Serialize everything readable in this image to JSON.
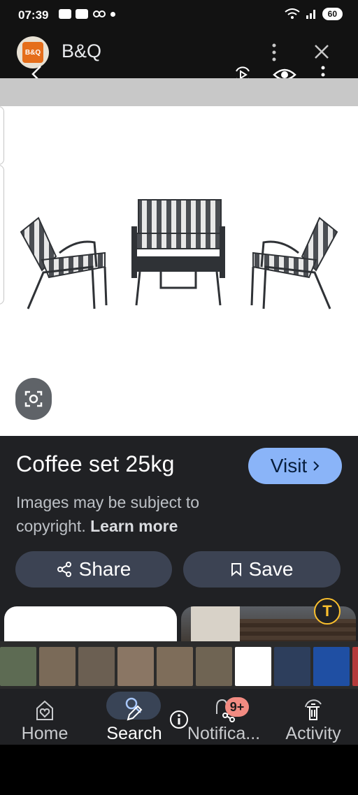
{
  "status_bar": {
    "time": "07:39",
    "battery": "60"
  },
  "header": {
    "brand_logo_text": "B&Q",
    "brand_name": "B&Q"
  },
  "product": {
    "title": "Coffee set 25kg",
    "visit_label": "Visit",
    "copyright_text": "Images may be subject to copyright.",
    "learn_more": "Learn more",
    "share_label": "Share",
    "save_label": "Save"
  },
  "visual_search": {
    "text_icon": "T"
  },
  "thumbnails": {
    "colors": [
      "#5d6b53",
      "#7a6a58",
      "#6b5f52",
      "#8a7664",
      "#7e6d5a",
      "#6f6453",
      "#ffffff",
      "#2d3e5c",
      "#1f4fa3",
      "#b43a3a",
      "#a8825e",
      "#d5c7b2",
      "#3b2f2c",
      "#e0c29a"
    ]
  },
  "bottom_nav": {
    "items": [
      {
        "label": "Home"
      },
      {
        "label": "Search"
      },
      {
        "label": "Notifica..."
      },
      {
        "label": "Activity"
      }
    ],
    "notifications_badge": "9+"
  },
  "colors": {
    "accent_visit": "#8ab4f8",
    "panel_bg": "#202124",
    "chip_bg": "#3c4353",
    "badge_bg": "#f28b82"
  }
}
